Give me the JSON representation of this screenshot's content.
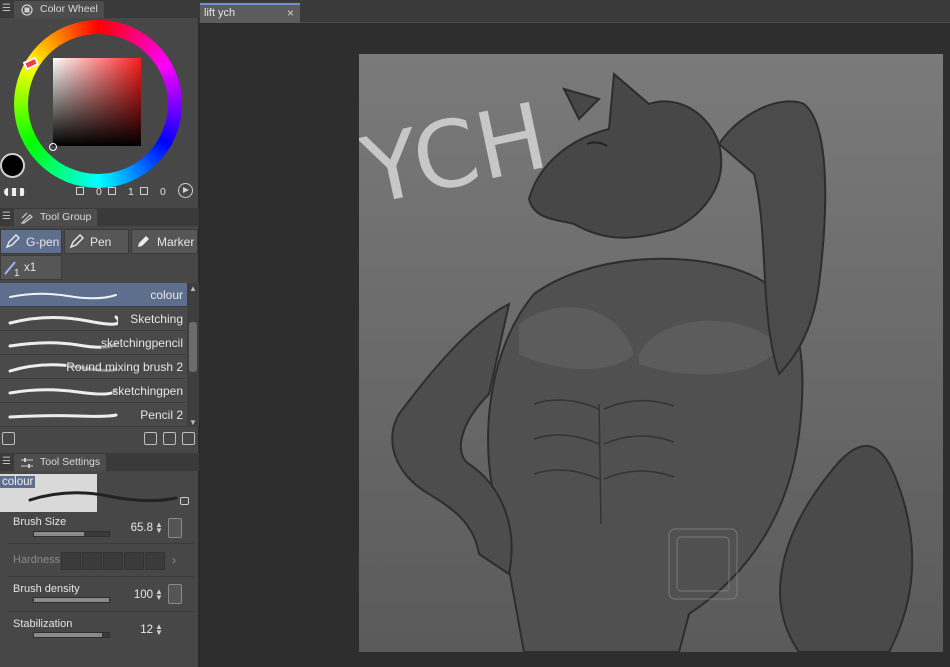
{
  "panels": {
    "color_wheel": {
      "title": "Color Wheel",
      "h_value": "0",
      "s_value": "1",
      "v_value": "0"
    },
    "tool_group": {
      "title": "Tool Group",
      "tools": [
        "G-pen",
        "Pen",
        "Marker"
      ],
      "active_tool": "G-pen",
      "sub_tool_count": "x1"
    },
    "brush_list": {
      "items": [
        {
          "name": "colour",
          "selected": true
        },
        {
          "name": "Sketching"
        },
        {
          "name": "sketchingpencil"
        },
        {
          "name": "Round mixing brush 2"
        },
        {
          "name": "sketchingpen"
        },
        {
          "name": "Pencil 2"
        }
      ]
    },
    "tool_settings": {
      "title": "Tool Settings",
      "preview_label": "colour",
      "brush_size": {
        "label": "Brush Size",
        "value": "65.8",
        "fill": 0.66
      },
      "hardness": {
        "label": "Hardness"
      },
      "brush_density": {
        "label": "Brush density",
        "value": "100",
        "fill": 1.0
      },
      "stabilization": {
        "label": "Stabilization",
        "value": "12",
        "fill": 0.9
      }
    }
  },
  "document": {
    "tab_label": "lift ych",
    "close_glyph": "×",
    "canvas_text": "YCH"
  },
  "colors": {
    "selection_blue": "#5d6f8c",
    "panel_bg": "#474747",
    "canvas_bg": "#2e2e2e",
    "foreground_color": "#000000",
    "background_color": "#ffffff"
  }
}
